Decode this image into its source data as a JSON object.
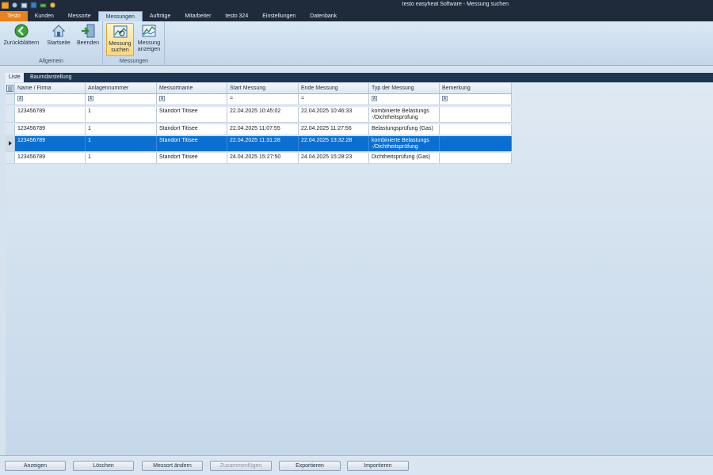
{
  "window": {
    "title": "testo easyheat Software - Messung suchen"
  },
  "quick_access": [
    "app-icon",
    "settings-icon",
    "tools-icon",
    "save-icon",
    "print-icon",
    "help-icon"
  ],
  "tabs": [
    {
      "label": "Testo",
      "type": "app"
    },
    {
      "label": "Kunden"
    },
    {
      "label": "Messorte"
    },
    {
      "label": "Messungen",
      "active": true
    },
    {
      "label": "Aufträge"
    },
    {
      "label": "Mitarbeiter"
    },
    {
      "label": "testo 324"
    },
    {
      "label": "Einstellungen"
    },
    {
      "label": "Datenbank"
    }
  ],
  "ribbon": {
    "group_allgemein": {
      "label": "Allgemein",
      "back": "Zurückblättern",
      "home": "Startseite",
      "exit": "Beenden"
    },
    "group_messungen": {
      "label": "Messungen",
      "search_line1": "Messung",
      "search_line2": "suchen",
      "show_line1": "Messung",
      "show_line2": "anzeigen"
    }
  },
  "subtabs": {
    "list": "Liste",
    "tree": "Baumdarstellung"
  },
  "grid": {
    "columns": [
      "Name / Firma",
      "Anlagennummer",
      "Messortname",
      "Start Messung",
      "Ende Messung",
      "Typ der Messung",
      "Bemerkung"
    ],
    "filter_types": [
      "text",
      "text",
      "text",
      "eq",
      "eq",
      "text",
      "text"
    ],
    "rows": [
      {
        "name": "123456789",
        "anlage": "1",
        "messort": "Standort Titisee",
        "start": "22.04.2025 10:45:02",
        "ende": "22.04.2025 10:46:33",
        "typ1": "kombinierte Belastungs",
        "typ2": "-/Dichtheitsprüfung",
        "bemerkung": ""
      },
      {
        "name": "123456789",
        "anlage": "1",
        "messort": "Standort Titisee",
        "start": "22.04.2025 11:07:55",
        "ende": "22.04.2025 11:27:56",
        "typ1": "Belastungsprüfung (Gas)",
        "typ2": "",
        "bemerkung": ""
      },
      {
        "name": "123456789",
        "anlage": "1",
        "messort": "Standort Titisee",
        "start": "22.04.2025 11:31:28",
        "ende": "22.04.2025 13:32:28",
        "typ1": "kombinierte Belastungs",
        "typ2": "-/Dichtheitsprüfung",
        "bemerkung": "",
        "selected": true
      },
      {
        "name": "123456789",
        "anlage": "1",
        "messort": "Standort Titisee",
        "start": "24.04.2025 15:27:50",
        "ende": "24.04.2025 15:28:23",
        "typ1": "Dichtheitsprüfung (Gas)",
        "typ2": "",
        "bemerkung": ""
      }
    ]
  },
  "bottom": {
    "show": "Anzeigen",
    "delete": "Löschen",
    "change_location": "Messort ändern",
    "merge": "Zusammenfügen",
    "export": "Exportieren",
    "import": "Importieren"
  },
  "colors": {
    "accent_app_tab": "#e8821e",
    "selection": "#0a6fd1",
    "titlebar": "#1f2a3a"
  }
}
